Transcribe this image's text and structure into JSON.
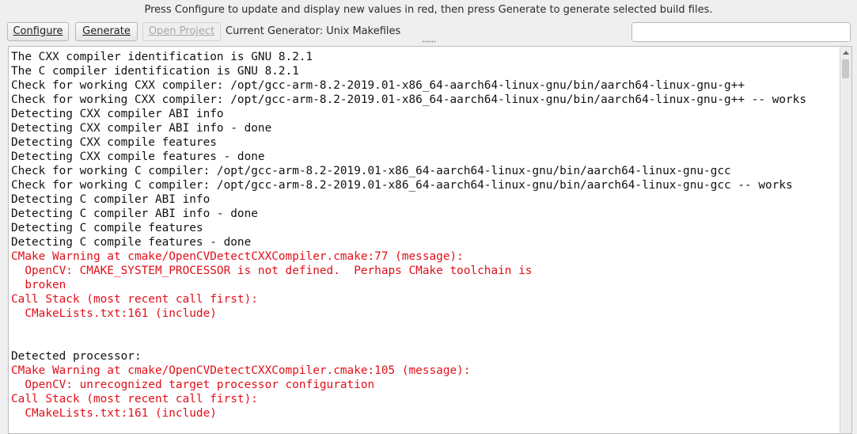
{
  "hint_text": "Press Configure to update and display new values in red, then press Generate to generate selected build files.",
  "toolbar": {
    "configure_label": "Configure",
    "generate_label": "Generate",
    "open_project_label": "Open Project",
    "current_generator": "Current Generator: Unix Makefiles",
    "search_value": ""
  },
  "colors": {
    "normal_text": "#111111",
    "warning_text": "#e0101a"
  },
  "output": {
    "lines": [
      {
        "text": "The CXX compiler identification is GNU 8.2.1",
        "color": "black"
      },
      {
        "text": "The C compiler identification is GNU 8.2.1",
        "color": "black"
      },
      {
        "text": "Check for working CXX compiler: /opt/gcc-arm-8.2-2019.01-x86_64-aarch64-linux-gnu/bin/aarch64-linux-gnu-g++",
        "color": "black"
      },
      {
        "text": "Check for working CXX compiler: /opt/gcc-arm-8.2-2019.01-x86_64-aarch64-linux-gnu/bin/aarch64-linux-gnu-g++ -- works",
        "color": "black"
      },
      {
        "text": "Detecting CXX compiler ABI info",
        "color": "black"
      },
      {
        "text": "Detecting CXX compiler ABI info - done",
        "color": "black"
      },
      {
        "text": "Detecting CXX compile features",
        "color": "black"
      },
      {
        "text": "Detecting CXX compile features - done",
        "color": "black"
      },
      {
        "text": "Check for working C compiler: /opt/gcc-arm-8.2-2019.01-x86_64-aarch64-linux-gnu/bin/aarch64-linux-gnu-gcc",
        "color": "black"
      },
      {
        "text": "Check for working C compiler: /opt/gcc-arm-8.2-2019.01-x86_64-aarch64-linux-gnu/bin/aarch64-linux-gnu-gcc -- works",
        "color": "black"
      },
      {
        "text": "Detecting C compiler ABI info",
        "color": "black"
      },
      {
        "text": "Detecting C compiler ABI info - done",
        "color": "black"
      },
      {
        "text": "Detecting C compile features",
        "color": "black"
      },
      {
        "text": "Detecting C compile features - done",
        "color": "black"
      },
      {
        "text": "CMake Warning at cmake/OpenCVDetectCXXCompiler.cmake:77 (message):",
        "color": "red"
      },
      {
        "text": "  OpenCV: CMAKE_SYSTEM_PROCESSOR is not defined.  Perhaps CMake toolchain is",
        "color": "red"
      },
      {
        "text": "  broken",
        "color": "red"
      },
      {
        "text": "Call Stack (most recent call first):",
        "color": "red"
      },
      {
        "text": "  CMakeLists.txt:161 (include)",
        "color": "red"
      },
      {
        "text": "",
        "color": "black"
      },
      {
        "text": "",
        "color": "black"
      },
      {
        "text": "Detected processor:",
        "color": "black"
      },
      {
        "text": "CMake Warning at cmake/OpenCVDetectCXXCompiler.cmake:105 (message):",
        "color": "red"
      },
      {
        "text": "  OpenCV: unrecognized target processor configuration",
        "color": "red"
      },
      {
        "text": "Call Stack (most recent call first):",
        "color": "red"
      },
      {
        "text": "  CMakeLists.txt:161 (include)",
        "color": "red"
      }
    ]
  }
}
